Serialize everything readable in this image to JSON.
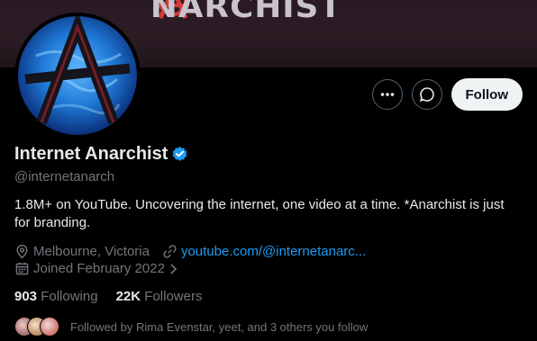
{
  "banner": {
    "text": "NARCHIST"
  },
  "profile": {
    "name": "Internet Anarchist",
    "handle": "@internetanarch",
    "bio": "1.8M+ on YouTube. Uncovering the internet, one video at a time. *Anarchist is just for branding.",
    "location": "Melbourne, Victoria",
    "website": "youtube.com/@internetanarc...",
    "joined": "Joined February 2022",
    "verified": true
  },
  "actions": {
    "follow_label": "Follow"
  },
  "stats": {
    "following_count": "903",
    "following_label": "Following",
    "followers_count": "22K",
    "followers_label": "Followers"
  },
  "followed_by": {
    "text": "Followed by Rima Evenstar, yeet, and 3 others you follow"
  },
  "colors": {
    "accent": "#1d9bf0",
    "muted": "#71767b",
    "text": "#e7e9ea",
    "background": "#000000"
  },
  "icons": [
    "more-icon",
    "message-icon",
    "verified-icon",
    "location-icon",
    "link-icon",
    "calendar-icon",
    "chevron-right-icon"
  ]
}
